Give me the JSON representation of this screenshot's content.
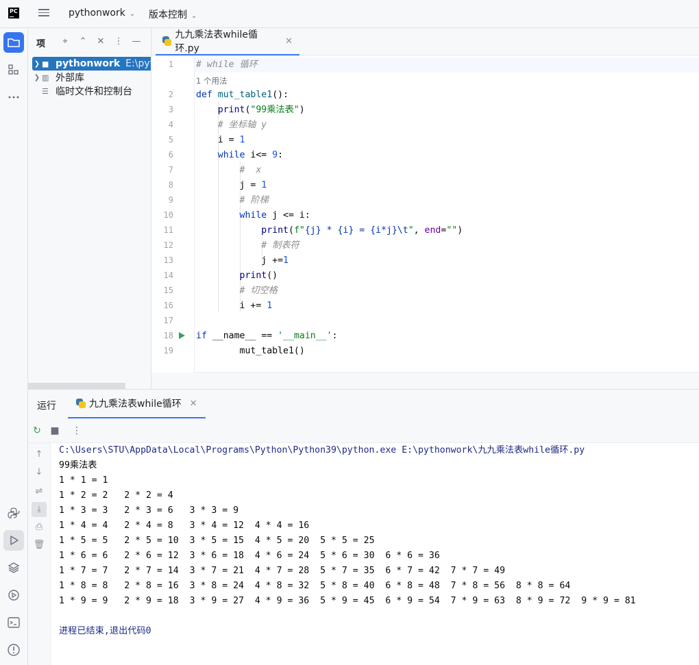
{
  "titlebar": {
    "logo_text": "PC",
    "project_name": "pythonwork",
    "vcs_label": "版本控制"
  },
  "left_strip": {
    "top_icons": [
      "folder-icon",
      "structure-icon",
      "more-icon"
    ],
    "bottom_icons": [
      "python-console-icon",
      "run-icon",
      "layers-icon",
      "services-icon",
      "terminal-icon",
      "problems-icon"
    ]
  },
  "project_panel": {
    "title": "项",
    "tree": [
      {
        "label": "pythonwork",
        "path": "E:\\pytho",
        "icon": "folder-icon",
        "expandable": true,
        "selected": true
      },
      {
        "label": "外部库",
        "icon": "library-icon",
        "expandable": true,
        "selected": false
      },
      {
        "label": "临时文件和控制台",
        "icon": "scratch-icon",
        "expandable": false,
        "selected": false
      }
    ]
  },
  "editor": {
    "tab_label": "九九乘法表while循环.py",
    "usage_hint": "1 个用法",
    "line_numbers": [
      "1",
      "2",
      "3",
      "4",
      "5",
      "6",
      "7",
      "8",
      "9",
      "10",
      "11",
      "12",
      "13",
      "14",
      "15",
      "16",
      "17",
      "18",
      "19"
    ],
    "lines": {
      "l1_comment": "# while 循环",
      "l2_def": "def",
      "l2_name": "mut_table1",
      "l2_rest": "():",
      "l3_print": "print",
      "l3_arg": "\"99乘法表\"",
      "l4_comment": "# 坐标轴 y",
      "l5_var": "i = ",
      "l5_num": "1",
      "l6_kw": "while",
      "l6_cond": " i<= ",
      "l6_num": "9",
      "l6_colon": ":",
      "l7_comment": "#  x",
      "l8_var": "j = ",
      "l8_num": "1",
      "l9_comment": "# 阶梯",
      "l10_kw": "while",
      "l10_cond": " j <= i:",
      "l11_print": "print",
      "l11_f": "f\"",
      "l11_fbody": "{j} * {i} = {i*j}\\t",
      "l11_fend": "\"",
      "l11_kw": "end",
      "l11_str": "\"\"",
      "l12_comment": "# 制表符",
      "l13_var": "j +=",
      "l13_num": "1",
      "l14_print": "print",
      "l15_comment": "# 切空格",
      "l16_var": "i += ",
      "l16_num": "1",
      "l18_if": "if",
      "l18_name": "__name__",
      "l18_eq": " == ",
      "l18_str": "'__main__'",
      "l18_colon": ":",
      "l19_call": "mut_table1()"
    }
  },
  "run_panel": {
    "title": "运行",
    "tab_label": "九九乘法表while循环",
    "console": [
      "C:\\Users\\STU\\AppData\\Local\\Programs\\Python\\Python39\\python.exe E:\\pythonwork\\九九乘法表while循环.py",
      "99乘法表",
      "1 * 1 = 1\t",
      "1 * 2 = 2\t2 * 2 = 4\t",
      "1 * 3 = 3\t2 * 3 = 6\t3 * 3 = 9\t",
      "1 * 4 = 4\t2 * 4 = 8\t3 * 4 = 12\t4 * 4 = 16\t",
      "1 * 5 = 5\t2 * 5 = 10\t3 * 5 = 15\t4 * 5 = 20\t5 * 5 = 25\t",
      "1 * 6 = 6\t2 * 6 = 12\t3 * 6 = 18\t4 * 6 = 24\t5 * 6 = 30\t6 * 6 = 36\t",
      "1 * 7 = 7\t2 * 7 = 14\t3 * 7 = 21\t4 * 7 = 28\t5 * 7 = 35\t6 * 7 = 42\t7 * 7 = 49\t",
      "1 * 8 = 8\t2 * 8 = 16\t3 * 8 = 24\t4 * 8 = 32\t5 * 8 = 40\t6 * 8 = 48\t7 * 8 = 56\t8 * 8 = 64\t",
      "1 * 9 = 9\t2 * 9 = 18\t3 * 9 = 27\t4 * 9 = 36\t5 * 9 = 45\t6 * 9 = 54\t7 * 9 = 63\t8 * 9 = 72\t9 * 9 = 81\t",
      "",
      "进程已结束,退出代码0"
    ]
  },
  "colors": {
    "accent": "#3574f0",
    "selection": "#2675bf",
    "keyword": "#0033b3",
    "string": "#067d17",
    "number": "#1750eb",
    "comment": "#8c8c8c",
    "run_green": "#3a9e5a"
  }
}
